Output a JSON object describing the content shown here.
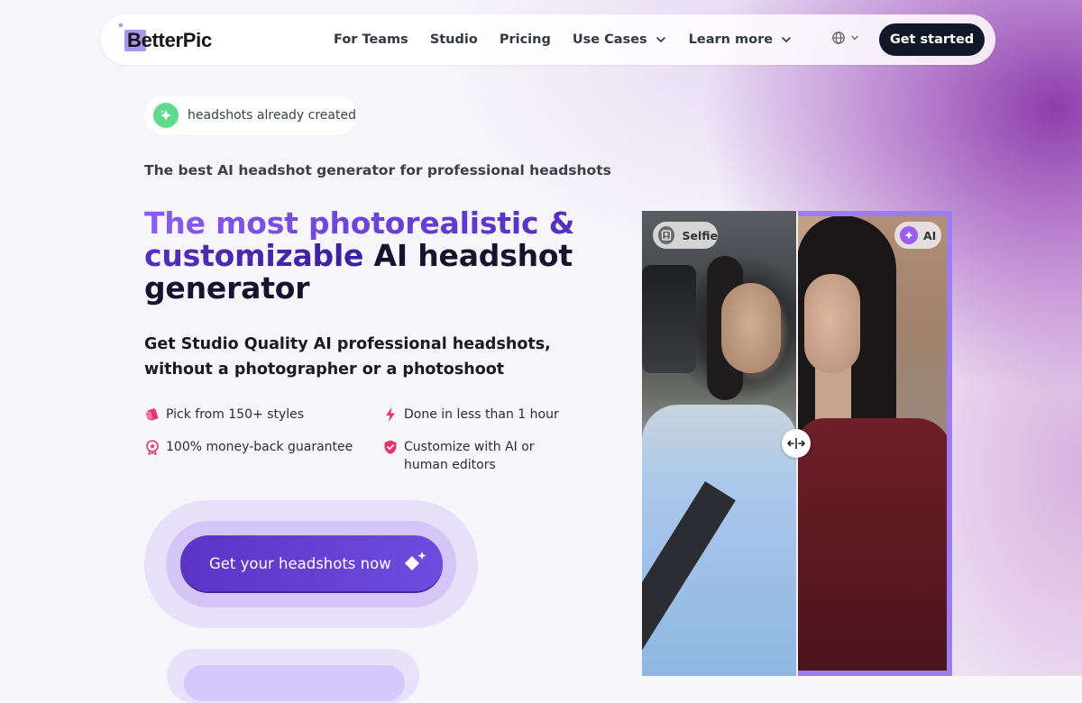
{
  "brand": {
    "name": "BetterPic",
    "accent": "#a896f0"
  },
  "nav": {
    "links": [
      {
        "label": "For Teams"
      },
      {
        "label": "Studio"
      },
      {
        "label": "Pricing"
      },
      {
        "label": "Use Cases"
      },
      {
        "label": "Learn more"
      }
    ],
    "language_icon": "globe-icon",
    "cta_label": "Get started"
  },
  "hero": {
    "badge_text": "headshots already created",
    "eyebrow": "The best AI headshot generator for professional headshots",
    "headline_gradient": "The most photorealistic & customizable",
    "headline_plain": " AI headshot generator",
    "subhead": "Get Studio Quality AI professional headshots, without a photographer or a photoshoot",
    "features": [
      {
        "text": "Pick from 150+ styles",
        "icon": "tag-icon"
      },
      {
        "text": "Done in less than 1 hour",
        "icon": "lightning-icon"
      },
      {
        "text": "100% money-back guarantee",
        "icon": "award-icon"
      },
      {
        "text": "Customize with AI or human editors",
        "icon": "shield-check-icon"
      }
    ],
    "cta_label": "Get your headshots now",
    "cta_color": "#5a34c4"
  },
  "comparison": {
    "left_label": "Selfie",
    "right_label": "AI",
    "frame_color": "#9b7df0"
  }
}
